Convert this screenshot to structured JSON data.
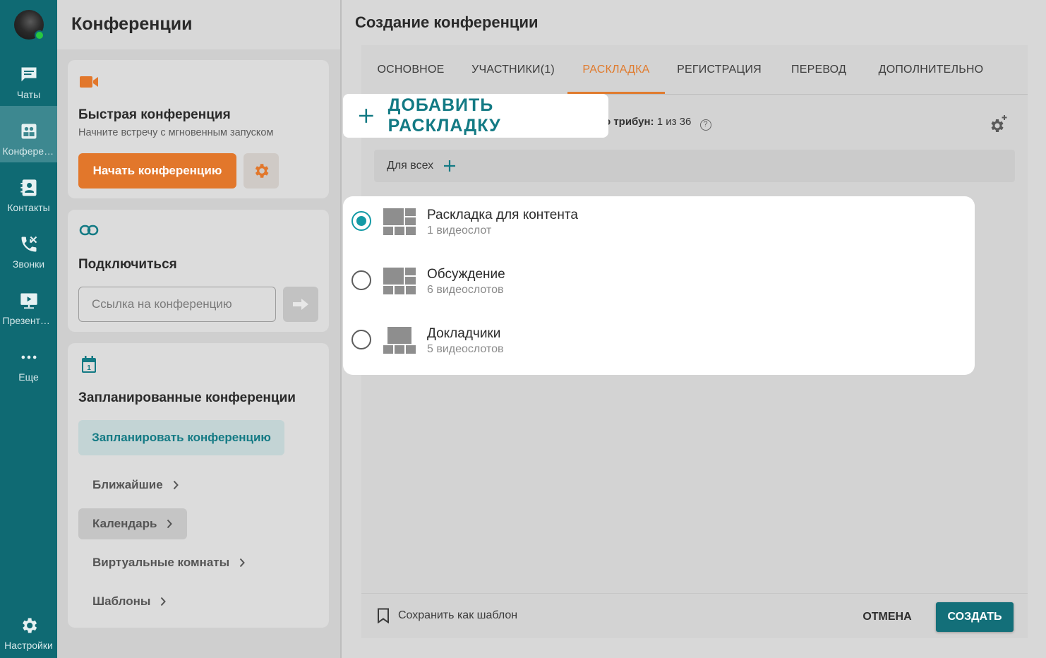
{
  "rail": {
    "items": [
      {
        "label": "Чаты",
        "icon": "chat-icon"
      },
      {
        "label": "Конференции",
        "icon": "conference-icon"
      },
      {
        "label": "Контакты",
        "icon": "contacts-icon"
      },
      {
        "label": "Звонки",
        "icon": "calls-icon"
      },
      {
        "label": "Презентации",
        "icon": "presentation-icon"
      },
      {
        "label": "Еще",
        "icon": "more-icon"
      }
    ],
    "settings_label": "Настройки"
  },
  "conferences": {
    "title": "Конференции",
    "quick": {
      "title": "Быстрая конференция",
      "subtitle": "Начните встречу с мгновенным запуском",
      "start_label": "Начать конференцию"
    },
    "connect": {
      "title": "Подключиться",
      "placeholder": "Ссылка на конференцию"
    },
    "scheduled": {
      "title": "Запланированные конференции",
      "schedule_label": "Запланировать конференцию",
      "links": [
        {
          "label": "Ближайшие"
        },
        {
          "label": "Календарь"
        },
        {
          "label": "Виртуальные комнаты"
        },
        {
          "label": "Шаблоны"
        }
      ]
    }
  },
  "create": {
    "title": "Создание конференции",
    "tabs": [
      {
        "label": "ОСНОВНОЕ"
      },
      {
        "label": "УЧАСТНИКИ(1)"
      },
      {
        "label": "РАСКЛАДКА"
      },
      {
        "label": "РЕГИСТРАЦИЯ"
      },
      {
        "label": "ПЕРЕВОД"
      },
      {
        "label": "ДОПОЛНИТЕЛЬНО"
      }
    ],
    "active_tab": "РАСКЛАДКА",
    "tribune_label": "о трибун:",
    "tribune_value": "1 из 36",
    "forall_label": "Для всех",
    "add_layout_label": "ДОБАВИТЬ РАСКЛАДКУ",
    "layouts": [
      {
        "name": "Раскладка для контента",
        "slots": "1 видеослот"
      },
      {
        "name": "Обсуждение",
        "slots": "6 видеослотов"
      },
      {
        "name": "Докладчики",
        "slots": "5 видеослотов"
      }
    ],
    "selected_layout": "Раскладка для контента",
    "save_template_label": "Сохранить как шаблон",
    "cancel_label": "ОТМЕНА",
    "create_label": "СОЗДАТЬ"
  },
  "colors": {
    "rail": "#0f6a73",
    "accent_orange": "#e2772b",
    "accent_teal": "#137a84",
    "radio_selected": "#139aa5"
  }
}
